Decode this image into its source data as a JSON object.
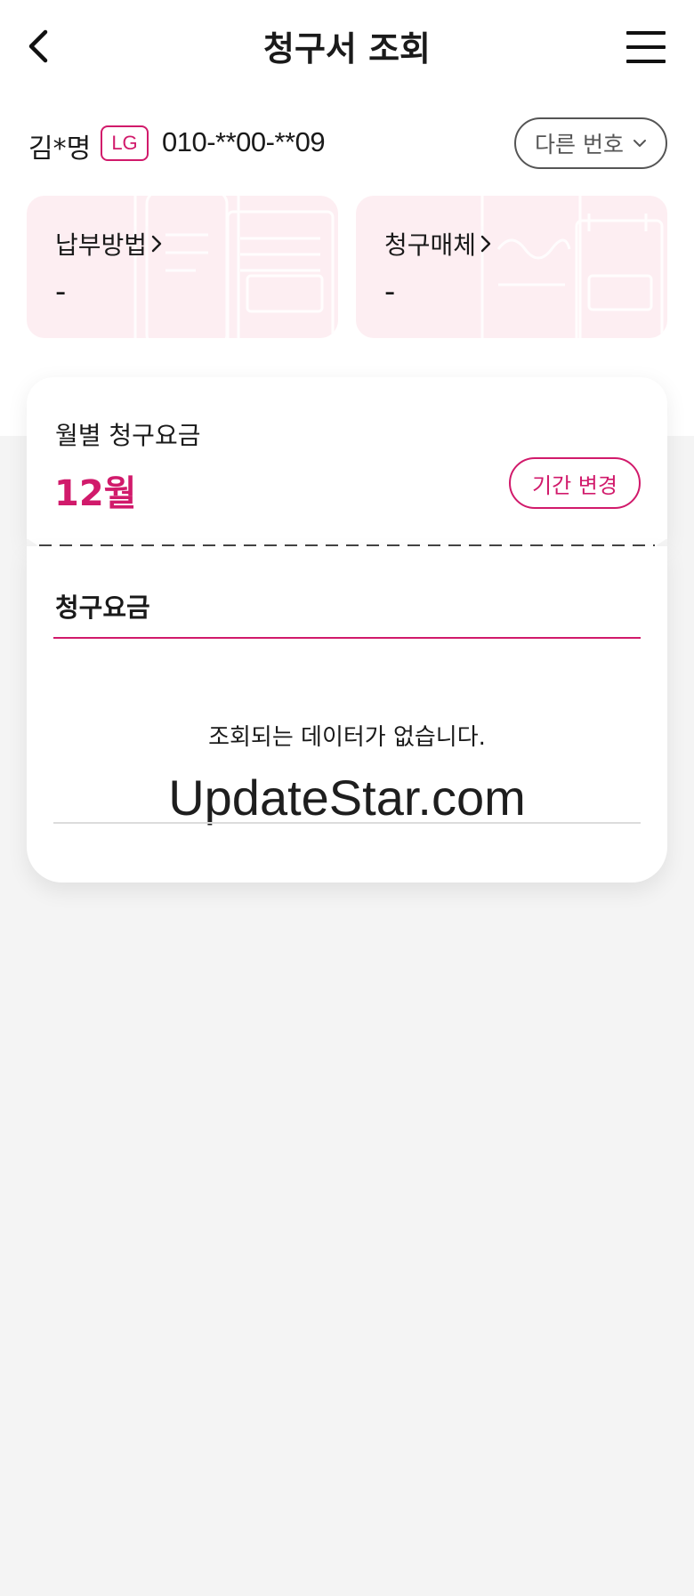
{
  "header": {
    "title": "청구서 조회",
    "back_icon": "chevron-left-icon",
    "menu_icon": "hamburger-menu-icon"
  },
  "user": {
    "name": "김*명",
    "carrier": "LG",
    "phone": "010-**00-**09",
    "other_number_label": "다른 번호"
  },
  "summary": {
    "payment_method": {
      "label": "납부방법",
      "value": "-"
    },
    "billing_medium": {
      "label": "청구매체",
      "value": "-"
    }
  },
  "monthly": {
    "label": "월별 청구요금",
    "month": "12월",
    "change_period_label": "기간 변경"
  },
  "bill": {
    "tab_label": "청구요금",
    "empty_message": "조회되는 데이터가 없습니다.",
    "watermark": "UpdateStar.com"
  },
  "colors": {
    "accent": "#d11a6b",
    "card_background": "#fdeef2",
    "page_background": "#f4f4f4"
  }
}
